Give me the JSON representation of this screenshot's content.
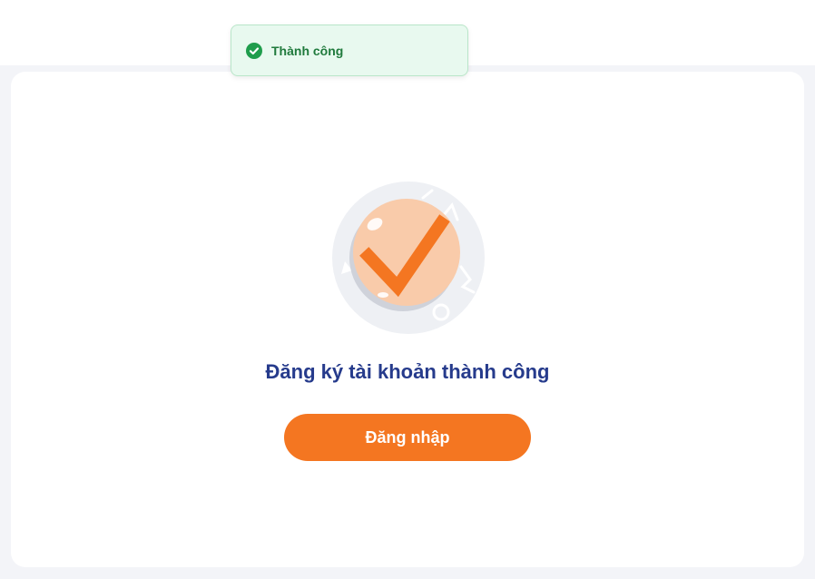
{
  "toast": {
    "message": "Thành công",
    "icon": "check-circle-icon",
    "color": "#1f7a3c"
  },
  "main": {
    "illustration_icon": "success-checkmark-icon",
    "title": "Đăng ký tài khoản thành công",
    "login_button": "Đăng nhập"
  },
  "colors": {
    "accent": "#f47621",
    "title": "#263b8c",
    "toast_bg": "#e8f9ef",
    "page_bg": "#f3f4f8"
  }
}
